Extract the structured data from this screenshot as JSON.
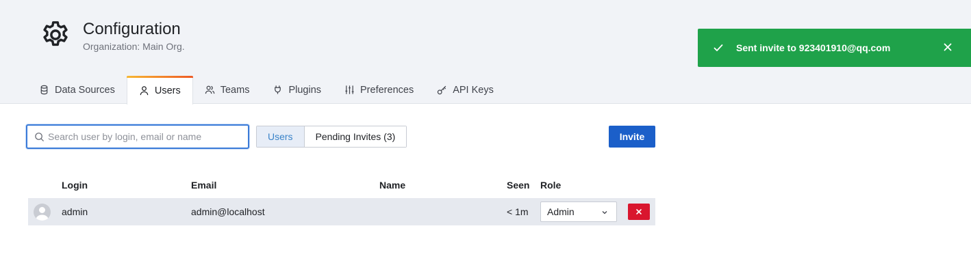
{
  "header": {
    "title": "Configuration",
    "subtitle": "Organization: Main Org."
  },
  "tabs": [
    {
      "label": "Data Sources",
      "icon": "database-icon",
      "active": false
    },
    {
      "label": "Users",
      "icon": "user-icon",
      "active": true
    },
    {
      "label": "Teams",
      "icon": "users-icon",
      "active": false
    },
    {
      "label": "Plugins",
      "icon": "plug-icon",
      "active": false
    },
    {
      "label": "Preferences",
      "icon": "sliders-icon",
      "active": false
    },
    {
      "label": "API Keys",
      "icon": "key-icon",
      "active": false
    }
  ],
  "toast": {
    "message": "Sent invite to 923401910@qq.com",
    "color": "#1fa24a"
  },
  "search": {
    "placeholder": "Search user by login, email or name",
    "value": ""
  },
  "filter": {
    "users_label": "Users",
    "pending_label": "Pending Invites (3)"
  },
  "invite_label": "Invite",
  "table": {
    "headers": {
      "login": "Login",
      "email": "Email",
      "name": "Name",
      "seen": "Seen",
      "role": "Role"
    },
    "rows": [
      {
        "login": "admin",
        "email": "admin@localhost",
        "name": "",
        "seen": "< 1m",
        "role": "Admin"
      }
    ]
  },
  "colors": {
    "primary": "#1b5fc9",
    "danger": "#d9162e",
    "success": "#1fa24a"
  }
}
